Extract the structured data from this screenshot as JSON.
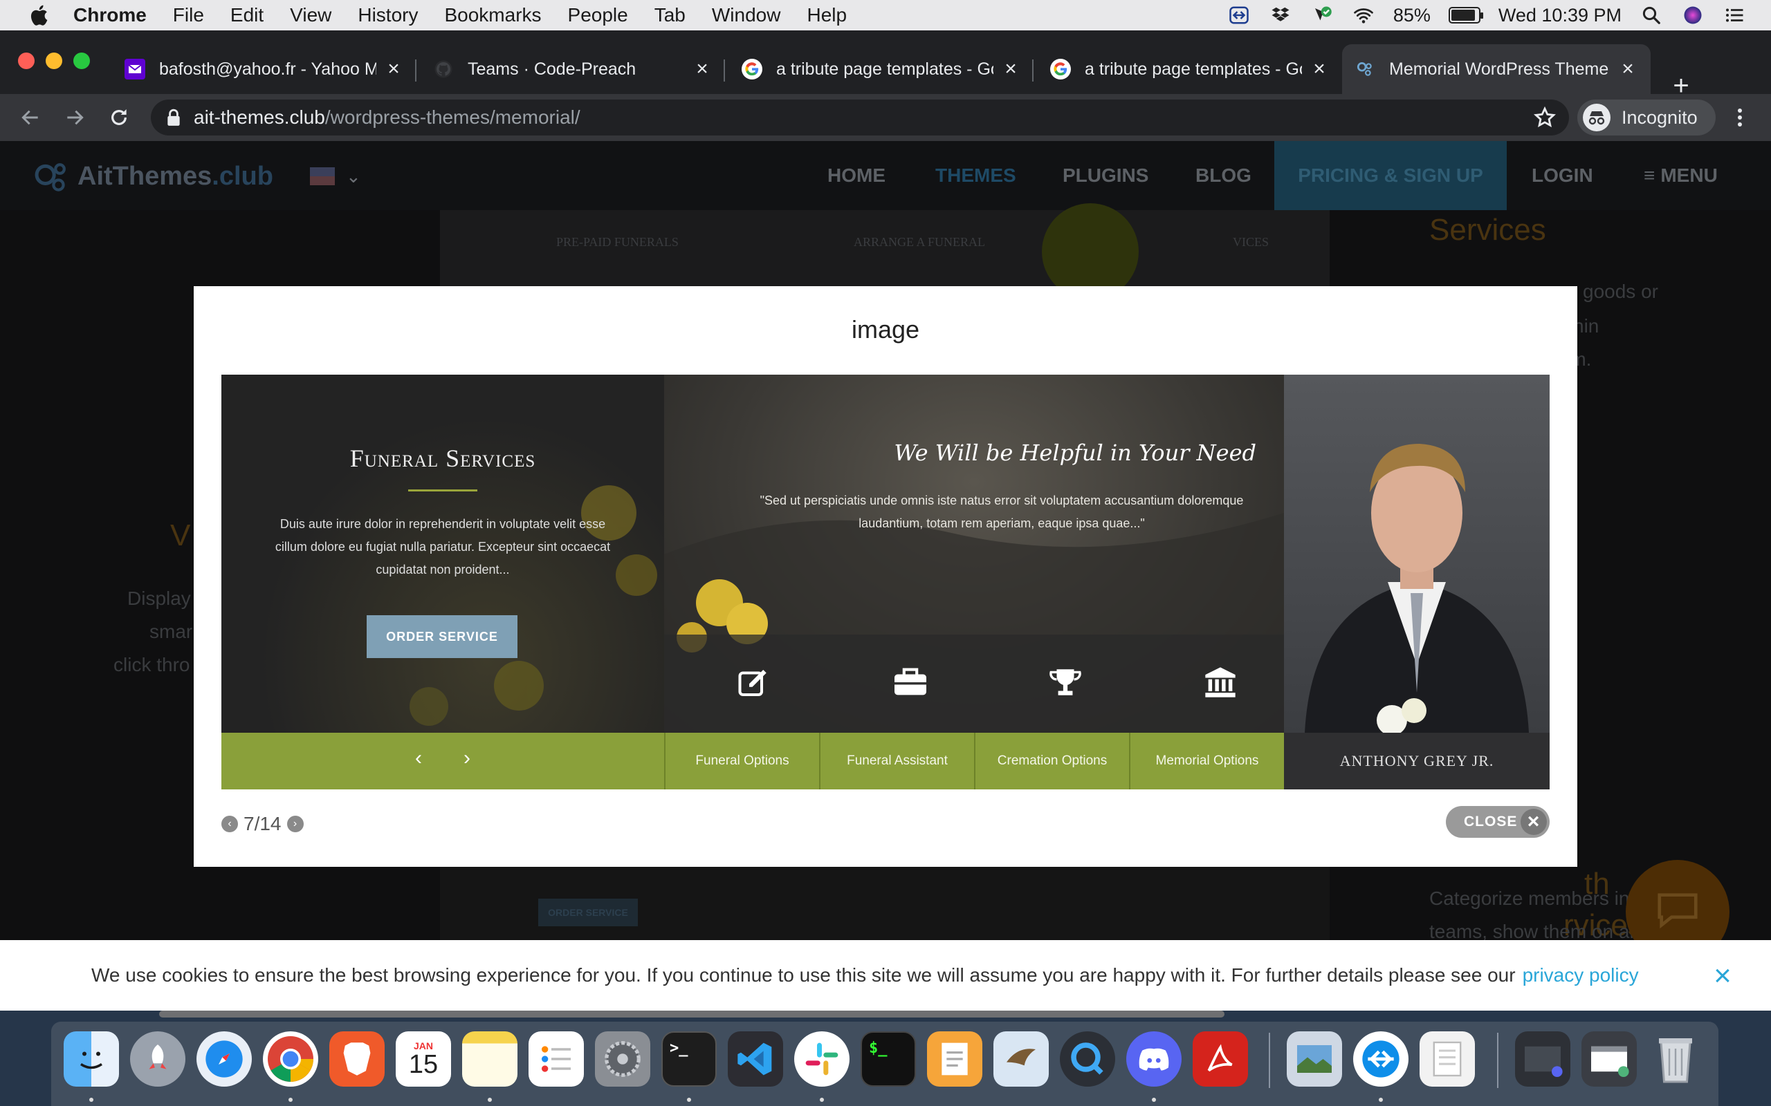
{
  "menubar": {
    "app": "Chrome",
    "items": [
      "File",
      "Edit",
      "View",
      "History",
      "Bookmarks",
      "People",
      "Tab",
      "Window",
      "Help"
    ],
    "battery": "85%",
    "battery_level": 0.85,
    "clock": "Wed 10:39 PM"
  },
  "tabs": [
    {
      "title": "bafosth@yahoo.fr - Yahoo Ma",
      "icon": "yahoo-mail-icon"
    },
    {
      "title": "Teams · Code-Preach",
      "icon": "github-icon"
    },
    {
      "title": "a tribute page templates - Go",
      "icon": "google-icon"
    },
    {
      "title": "a tribute page templates - Go",
      "icon": "google-icon"
    },
    {
      "title": "Memorial WordPress Theme | ",
      "icon": "aitthemes-icon",
      "active": true
    }
  ],
  "toolbar": {
    "url_host": "ait-themes.club",
    "url_path": "/wordpress-themes/memorial/",
    "profile_label": "Incognito"
  },
  "site": {
    "logo_a": "AitThemes",
    "logo_b": ".club",
    "nav": [
      "HOME",
      "THEMES",
      "PLUGINS",
      "BLOG",
      "PRICING & SIGN UP",
      "LOGIN",
      "MENU"
    ],
    "bg_strip": [
      "PRE-PAID FUNERALS",
      "ARRANGE A FUNERAL",
      "VICES"
    ],
    "bg_right_heading": "Services",
    "bg_right_lines": [
      "goods or",
      "ithin",
      "rm."
    ],
    "bg_left_lines": [
      "Display",
      "smar",
      "click thro"
    ],
    "bg_left_big": "V",
    "bg_bottom_heading_a": "th",
    "bg_bottom_heading_b": "rvices",
    "bg_bottom_text_a": "Categorize members int",
    "bg_bottom_text_b": "teams, show them on any",
    "bg_order_btn": "ORDER SERVICE"
  },
  "lightbox": {
    "title": "image",
    "counter": "7/14",
    "close_label": "CLOSE",
    "slide": {
      "left_heading": "Funeral Services",
      "left_text": "Duis aute irure dolor in reprehenderit in voluptate velit esse cillum dolore eu fugiat nulla pariatur. Excepteur sint occaecat cupidatat non proident...",
      "order_button": "ORDER SERVICE",
      "script_heading": "We Will be Helpful in Your Need",
      "quote": "\"Sed ut perspiciatis unde omnis iste natus error sit voluptatem accusantium doloremque laudantium, totam rem aperiam, eaque ipsa quae...\"",
      "tabs": [
        "Funeral Options",
        "Funeral Assistant",
        "Cremation Options",
        "Memorial Options"
      ],
      "person_name": "ANTHONY GREY JR."
    }
  },
  "cookie": {
    "text": "We use cookies to ensure the best browsing experience for you. If you continue to use this site we will assume you are happy with it. For further details please see our",
    "link": "privacy policy"
  },
  "dock": {
    "calendar_month": "JAN",
    "calendar_day": "15",
    "apps": [
      "finder-icon",
      "launchpad-icon",
      "safari-icon",
      "chrome-icon",
      "brave-icon",
      "calendar-icon",
      "notes-icon",
      "reminders-icon",
      "system-preferences-icon",
      "terminal-icon",
      "vscode-icon",
      "slack-icon",
      "iterm-icon",
      "pages-icon",
      "mail-icon",
      "quicktime-icon",
      "discord-icon",
      "acrobat-icon",
      "preview-icon",
      "teamviewer-icon",
      "textedit-icon",
      "screenshots-icon",
      "window-icon",
      "trash-icon"
    ]
  },
  "colors": {
    "slide_green": "#8aa03a",
    "link_blue": "#2aa6d8",
    "order_button": "#7fa0b5"
  }
}
